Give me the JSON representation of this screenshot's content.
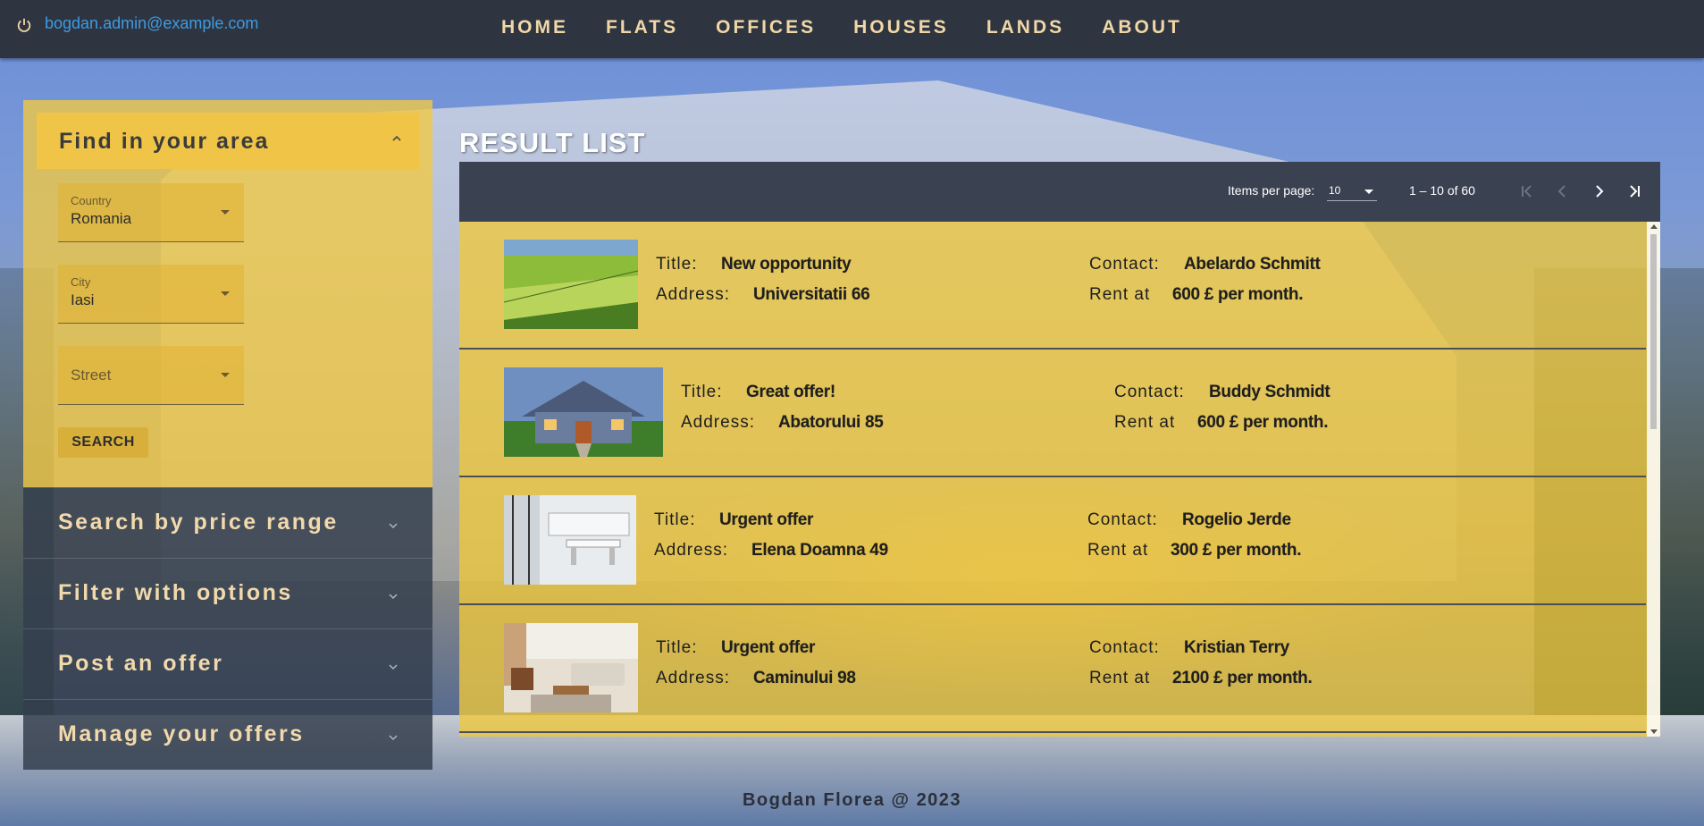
{
  "header": {
    "user_email": "bogdan.admin@example.com",
    "nav": [
      "HOME",
      "FLATS",
      "OFFICES",
      "HOUSES",
      "LANDS",
      "ABOUT"
    ]
  },
  "sidebar": {
    "open_panel": {
      "title": "Find in your area",
      "country": {
        "label": "Country",
        "value": "Romania"
      },
      "city": {
        "label": "City",
        "value": "Iasi"
      },
      "street": {
        "placeholder": "Street"
      },
      "search_label": "SEARCH"
    },
    "panels": [
      "Search by price range",
      "Filter with options",
      "Post an offer",
      "Manage your offers"
    ]
  },
  "results": {
    "title": "RESULT LIST",
    "paginator": {
      "items_per_page_label": "Items per page:",
      "items_per_page": "10",
      "range": "1 – 10 of 60"
    },
    "labels": {
      "title": "Title:",
      "address": "Address:",
      "contact": "Contact:",
      "rent": "Rent at"
    },
    "items": [
      {
        "title": "New opportunity",
        "address": "Universitatii 66",
        "contact": "Abelardo Schmitt",
        "rent": "600 £ per month.",
        "image": "green-field-photo"
      },
      {
        "title": "Great offer!",
        "address": "Abatorului 85",
        "contact": "Buddy Schmidt",
        "rent": "600 £ per month.",
        "image": "house-photo"
      },
      {
        "title": "Urgent offer",
        "address": "Elena Doamna 49",
        "contact": "Rogelio Jerde",
        "rent": "300 £ per month.",
        "image": "office-photo"
      },
      {
        "title": "Urgent offer",
        "address": "Caminului 98",
        "contact": "Kristian Terry",
        "rent": "2100 £ per month.",
        "image": "living-room-photo"
      }
    ]
  },
  "footer": {
    "text": "Bogdan Florea @ 2023"
  },
  "colors": {
    "navbar": "#2e3541",
    "accent_yellow": "#f0c846",
    "nav_text": "#f1d7a6",
    "email": "#3d9be3"
  }
}
